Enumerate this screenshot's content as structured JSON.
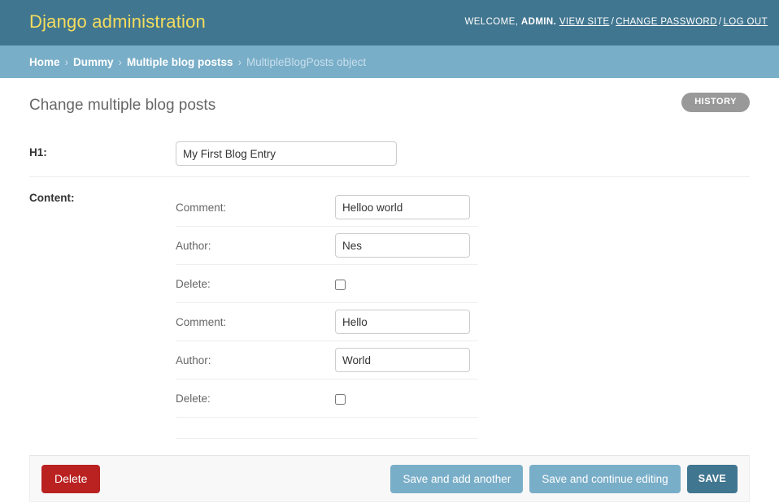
{
  "header": {
    "site_name": "Django administration",
    "welcome_prefix": "WELCOME,",
    "username": "ADMIN.",
    "view_site": "VIEW SITE",
    "change_password": "CHANGE PASSWORD",
    "log_out": "LOG OUT",
    "separator": "/",
    "brand_color": "#f5dd5d",
    "bg_color": "#417690"
  },
  "breadcrumbs": {
    "separator": "›",
    "items": [
      {
        "label": "Home",
        "is_link": true
      },
      {
        "label": "Dummy",
        "is_link": true
      },
      {
        "label": "Multiple blog postss",
        "is_link": true
      },
      {
        "label": "MultipleBlogPosts object",
        "is_link": false
      }
    ],
    "bg_color": "#79aec8"
  },
  "page": {
    "title": "Change multiple blog posts",
    "history_button": "HISTORY"
  },
  "form": {
    "main_field": {
      "label": "H1:",
      "value": "My First Blog Entry",
      "placeholder": ""
    },
    "inline_section": {
      "label": "Content:",
      "groups": [
        {
          "comment_label": "Comment:",
          "comment_value": "Helloo world",
          "author_label": "Author:",
          "author_value": "Nes",
          "delete_label": "Delete:",
          "delete_checked": false
        },
        {
          "comment_label": "Comment:",
          "comment_value": "Hello",
          "author_label": "Author:",
          "author_value": "World",
          "delete_label": "Delete:",
          "delete_checked": false
        }
      ]
    }
  },
  "submit_row": {
    "delete_label": "Delete",
    "save_add_another_label": "Save and add another",
    "save_continue_label": "Save and continue editing",
    "save_label": "SAVE",
    "delete_color": "#ba2121",
    "default_color": "#79aec8",
    "save_color": "#417690"
  }
}
